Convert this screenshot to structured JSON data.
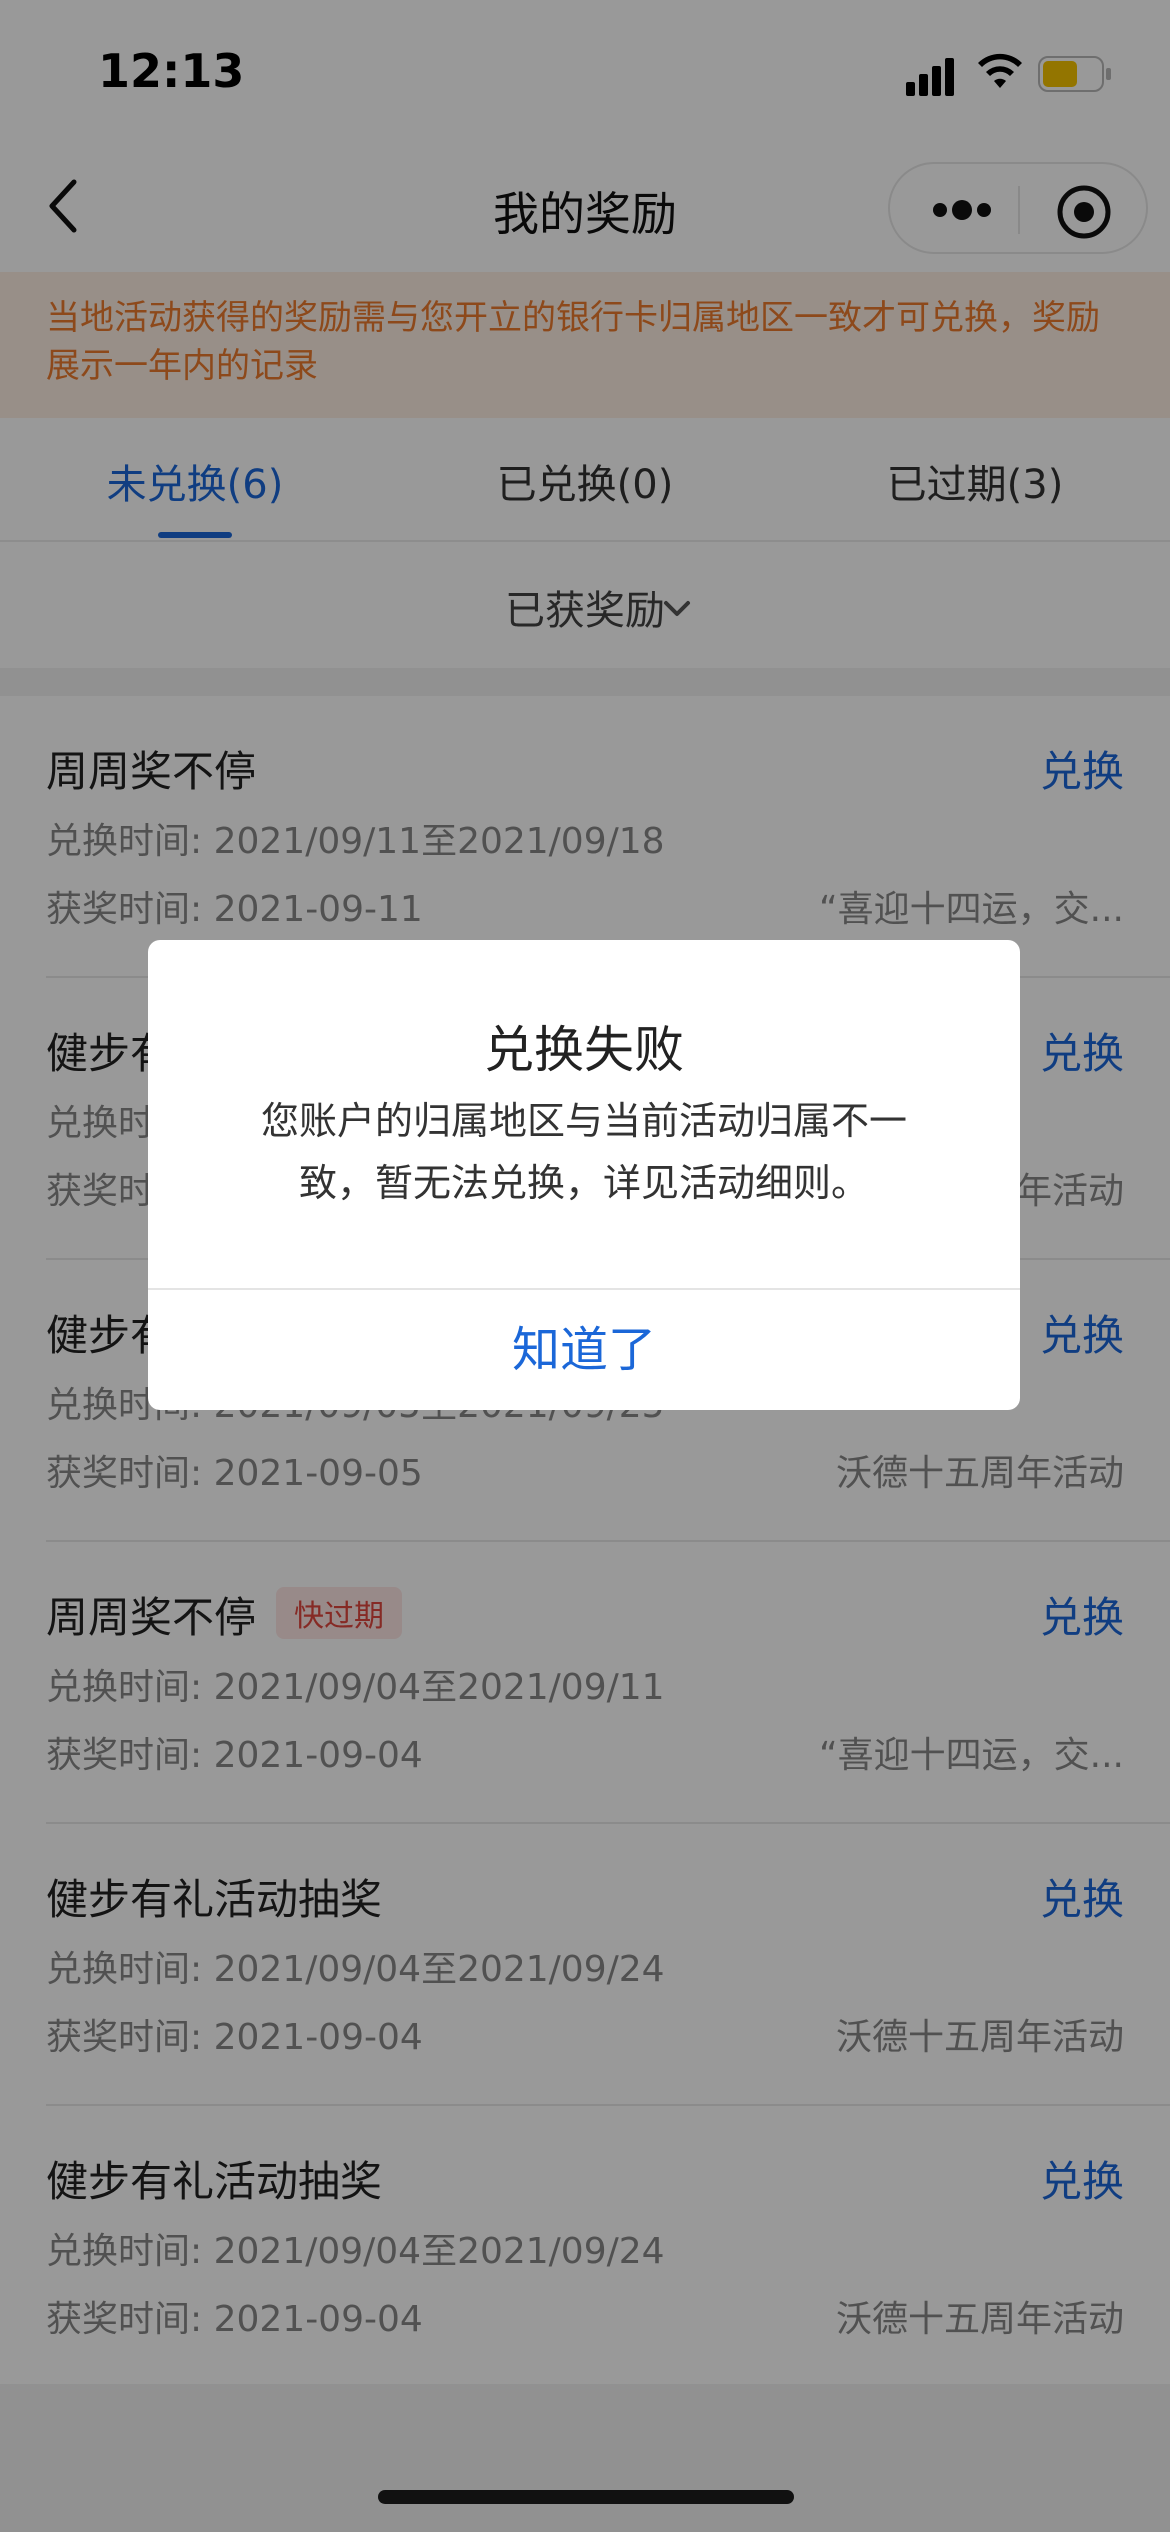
{
  "status_bar": {
    "time": "12:13"
  },
  "nav": {
    "title": "我的奖励"
  },
  "notice": {
    "text": "当地活动获得的奖励需与您开立的银行卡归属地区一致才可兑换，奖励展示一年内的记录"
  },
  "tabs": [
    {
      "label": "未兑换(6)"
    },
    {
      "label": "已兑换(0)"
    },
    {
      "label": "已过期(3)"
    }
  ],
  "filter": {
    "label": "已获奖励"
  },
  "items": [
    {
      "title": "周周奖不停",
      "tag": "",
      "action": "兑换",
      "redeem_time": "兑换时间: 2021/09/11至2021/09/18",
      "award_time": "获奖时间: 2021-09-11",
      "source": "“喜迎十四运，交..."
    },
    {
      "title": "健步有礼活动抽奖",
      "tag": "",
      "action": "兑换",
      "redeem_time": "兑换时间: 2021/09/05至2021/09/25",
      "award_time": "获奖时间: 2021-09-05",
      "source": "沃德十五周年活动"
    },
    {
      "title": "健步有礼活动抽奖",
      "tag": "",
      "action": "兑换",
      "redeem_time": "兑换时间: 2021/09/05至2021/09/25",
      "award_time": "获奖时间: 2021-09-05",
      "source": "沃德十五周年活动"
    },
    {
      "title": "周周奖不停",
      "tag": "快过期",
      "action": "兑换",
      "redeem_time": "兑换时间: 2021/09/04至2021/09/11",
      "award_time": "获奖时间: 2021-09-04",
      "source": "“喜迎十四运，交..."
    },
    {
      "title": "健步有礼活动抽奖",
      "tag": "",
      "action": "兑换",
      "redeem_time": "兑换时间: 2021/09/04至2021/09/24",
      "award_time": "获奖时间: 2021-09-04",
      "source": "沃德十五周年活动"
    },
    {
      "title": "健步有礼活动抽奖",
      "tag": "",
      "action": "兑换",
      "redeem_time": "兑换时间: 2021/09/04至2021/09/24",
      "award_time": "获奖时间: 2021-09-04",
      "source": "沃德十五周年活动"
    }
  ],
  "dialog": {
    "title": "兑换失败",
    "message": "您账户的归属地区与当前活动归属不一致，暂无法兑换，详见活动细则。",
    "button": "知道了"
  },
  "colors": {
    "accent": "#1b67d8",
    "notice_text": "#ec7b2d",
    "notice_bg": "#fdeee3",
    "tag_red": "#e0473f"
  }
}
